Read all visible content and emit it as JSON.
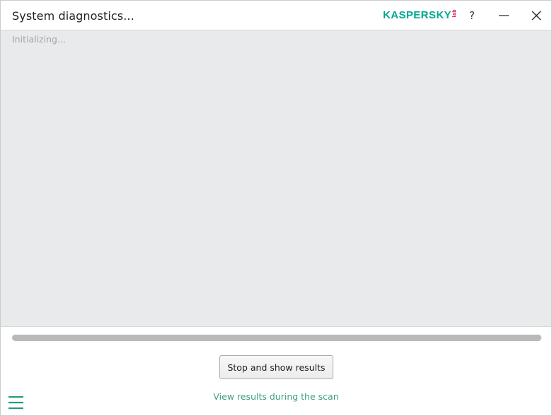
{
  "window": {
    "title": "System diagnostics...",
    "brand": "KASPERSKY",
    "brand_suffix": "lab",
    "help_label": "?",
    "colors": {
      "brand": "#00a88e",
      "lab": "#e6004c",
      "link": "#3e9e85"
    },
    "icons": [
      "help-icon",
      "minimize-icon",
      "close-icon",
      "menu-icon"
    ]
  },
  "content": {
    "status": "Initializing..."
  },
  "footer": {
    "progress": 100,
    "stop_button": "Stop and show results",
    "view_link": "View results during the scan"
  }
}
